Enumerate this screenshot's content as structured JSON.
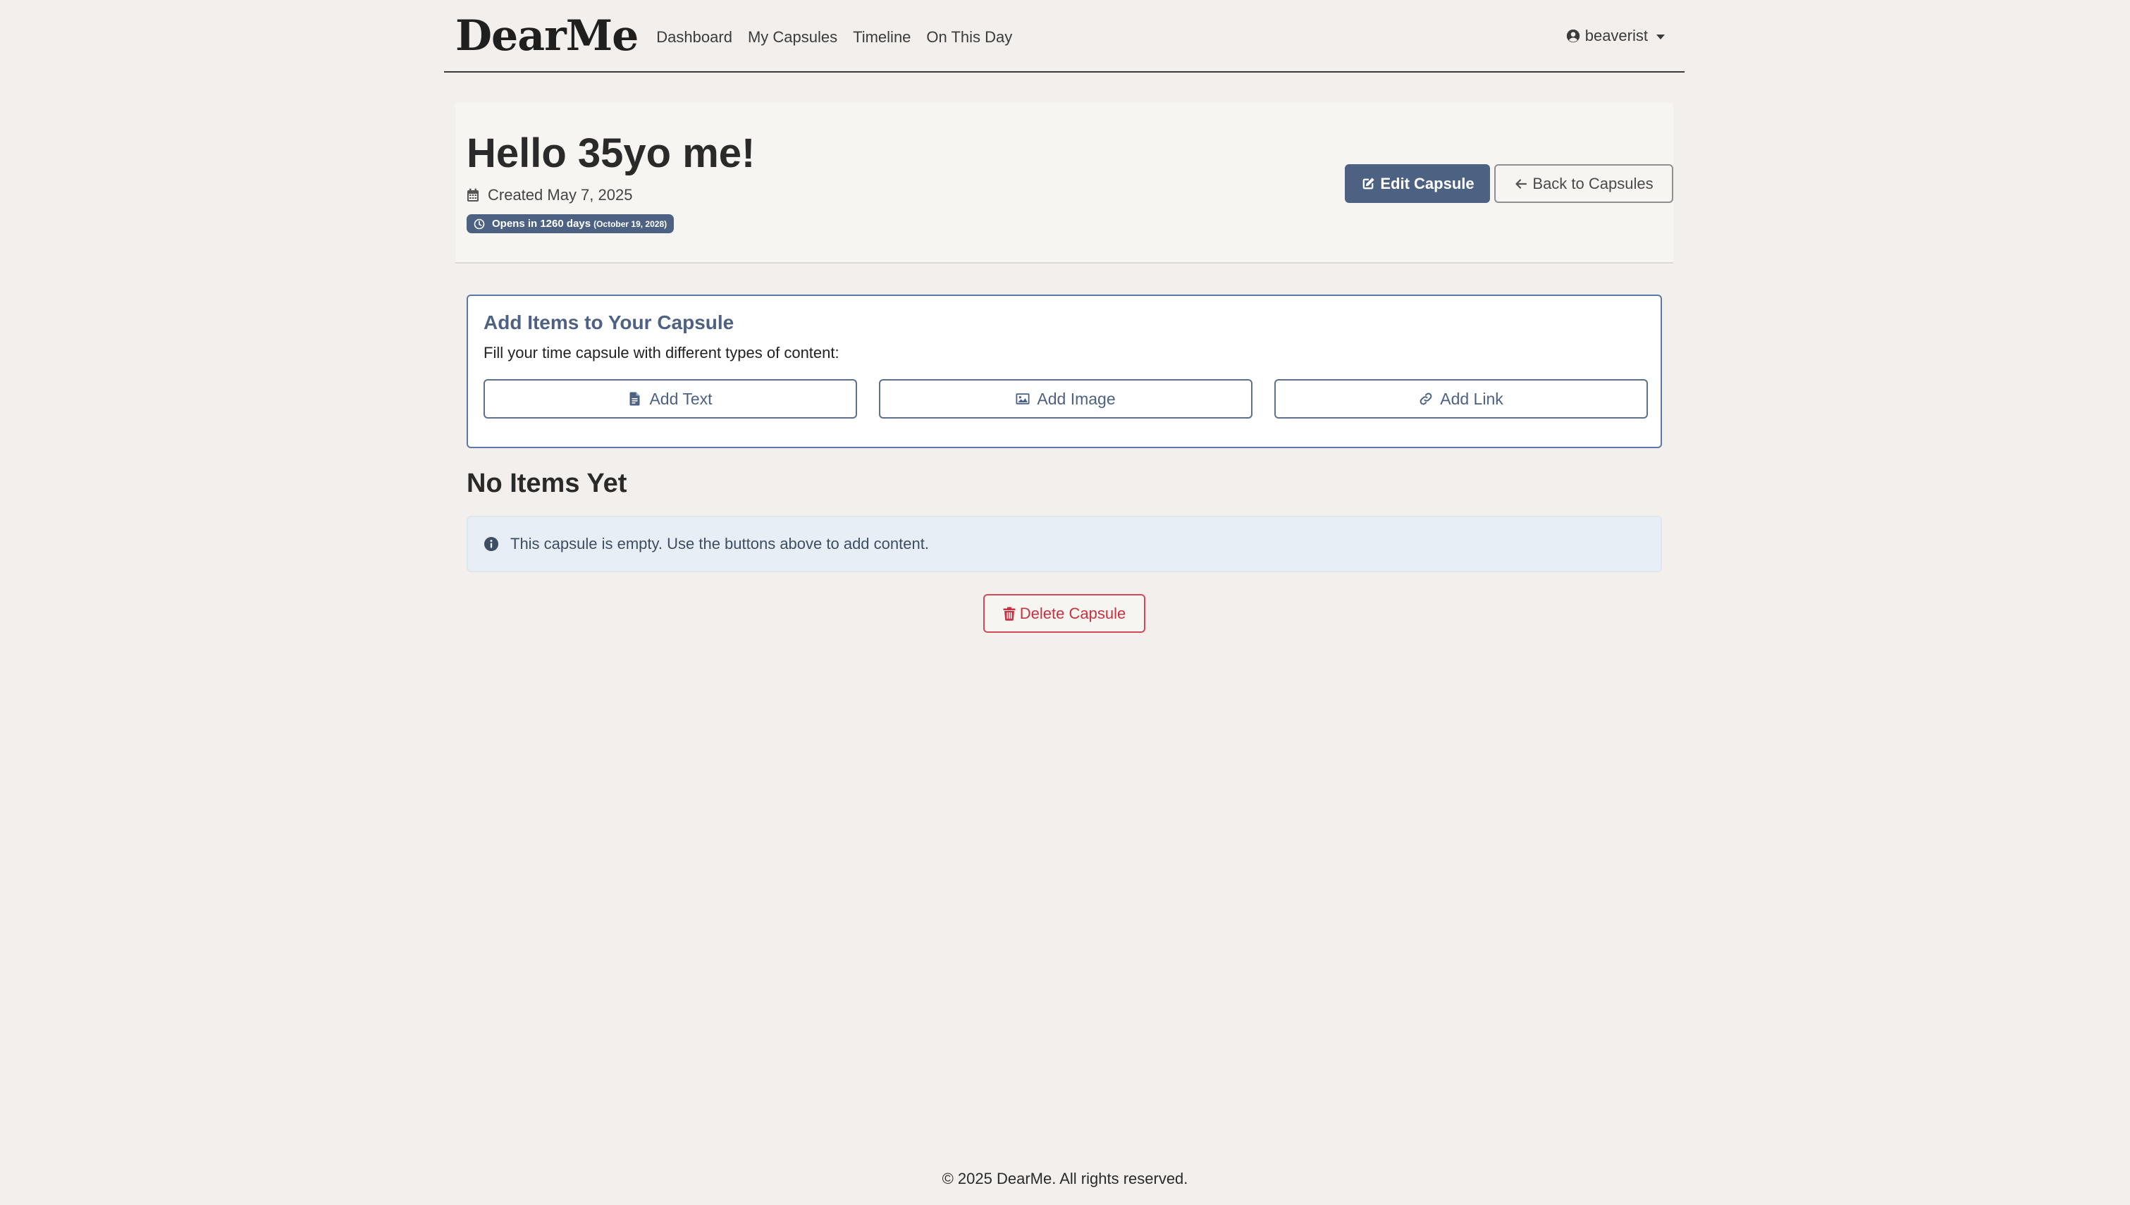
{
  "nav": {
    "brand": "DearMe",
    "links": [
      "Dashboard",
      "My Capsules",
      "Timeline",
      "On This Day"
    ],
    "username": "beaverist"
  },
  "capsule": {
    "title": "Hello 35yo me!",
    "created": "Created May 7, 2025",
    "opens_label": "Opens in 1260 days",
    "opens_date": "(October 19, 2028)",
    "edit_label": "Edit Capsule",
    "back_label": "Back to Capsules"
  },
  "add_items": {
    "heading": "Add Items to Your Capsule",
    "description": "Fill your time capsule with different types of content:",
    "text_label": "Add Text",
    "image_label": "Add Image",
    "link_label": "Add Link"
  },
  "items": {
    "heading": "No Items Yet",
    "empty_message": "This capsule is empty. Use the buttons above to add content."
  },
  "delete_label": "Delete Capsule",
  "footer": "© 2025 DearMe. All rights reserved.",
  "colors": {
    "accent": "#4d6283",
    "danger": "#c73240",
    "background": "#f2efec",
    "info_bg": "#e8eef5"
  },
  "icons": {
    "user": "user-circle-icon",
    "calendar": "calendar-icon",
    "clock": "clock-icon",
    "edit": "edit-icon",
    "back": "arrow-left-icon",
    "text": "file-text-icon",
    "image": "image-icon",
    "link": "link-icon",
    "info": "info-circle-icon",
    "trash": "trash-icon"
  }
}
